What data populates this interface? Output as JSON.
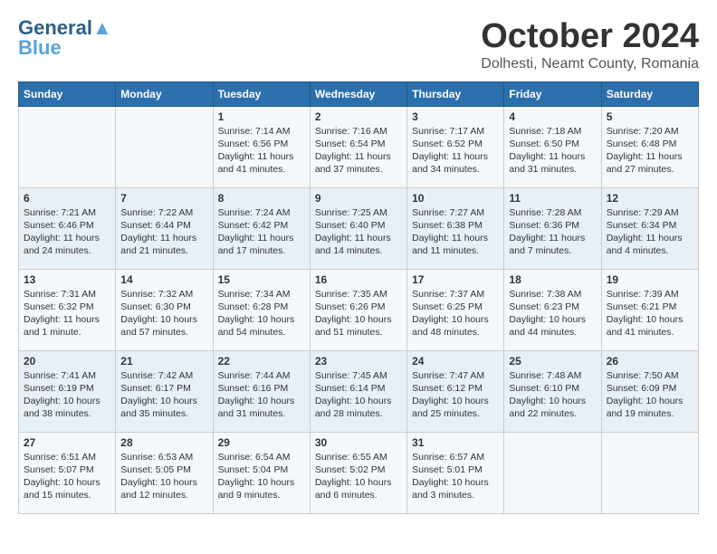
{
  "header": {
    "logo_general": "General",
    "logo_blue": "Blue",
    "month_title": "October 2024",
    "location": "Dolhesti, Neamt County, Romania"
  },
  "weekdays": [
    "Sunday",
    "Monday",
    "Tuesday",
    "Wednesday",
    "Thursday",
    "Friday",
    "Saturday"
  ],
  "weeks": [
    [
      {
        "day": "",
        "info": ""
      },
      {
        "day": "",
        "info": ""
      },
      {
        "day": "1",
        "info": "Sunrise: 7:14 AM\nSunset: 6:56 PM\nDaylight: 11 hours and 41 minutes."
      },
      {
        "day": "2",
        "info": "Sunrise: 7:16 AM\nSunset: 6:54 PM\nDaylight: 11 hours and 37 minutes."
      },
      {
        "day": "3",
        "info": "Sunrise: 7:17 AM\nSunset: 6:52 PM\nDaylight: 11 hours and 34 minutes."
      },
      {
        "day": "4",
        "info": "Sunrise: 7:18 AM\nSunset: 6:50 PM\nDaylight: 11 hours and 31 minutes."
      },
      {
        "day": "5",
        "info": "Sunrise: 7:20 AM\nSunset: 6:48 PM\nDaylight: 11 hours and 27 minutes."
      }
    ],
    [
      {
        "day": "6",
        "info": "Sunrise: 7:21 AM\nSunset: 6:46 PM\nDaylight: 11 hours and 24 minutes."
      },
      {
        "day": "7",
        "info": "Sunrise: 7:22 AM\nSunset: 6:44 PM\nDaylight: 11 hours and 21 minutes."
      },
      {
        "day": "8",
        "info": "Sunrise: 7:24 AM\nSunset: 6:42 PM\nDaylight: 11 hours and 17 minutes."
      },
      {
        "day": "9",
        "info": "Sunrise: 7:25 AM\nSunset: 6:40 PM\nDaylight: 11 hours and 14 minutes."
      },
      {
        "day": "10",
        "info": "Sunrise: 7:27 AM\nSunset: 6:38 PM\nDaylight: 11 hours and 11 minutes."
      },
      {
        "day": "11",
        "info": "Sunrise: 7:28 AM\nSunset: 6:36 PM\nDaylight: 11 hours and 7 minutes."
      },
      {
        "day": "12",
        "info": "Sunrise: 7:29 AM\nSunset: 6:34 PM\nDaylight: 11 hours and 4 minutes."
      }
    ],
    [
      {
        "day": "13",
        "info": "Sunrise: 7:31 AM\nSunset: 6:32 PM\nDaylight: 11 hours and 1 minute."
      },
      {
        "day": "14",
        "info": "Sunrise: 7:32 AM\nSunset: 6:30 PM\nDaylight: 10 hours and 57 minutes."
      },
      {
        "day": "15",
        "info": "Sunrise: 7:34 AM\nSunset: 6:28 PM\nDaylight: 10 hours and 54 minutes."
      },
      {
        "day": "16",
        "info": "Sunrise: 7:35 AM\nSunset: 6:26 PM\nDaylight: 10 hours and 51 minutes."
      },
      {
        "day": "17",
        "info": "Sunrise: 7:37 AM\nSunset: 6:25 PM\nDaylight: 10 hours and 48 minutes."
      },
      {
        "day": "18",
        "info": "Sunrise: 7:38 AM\nSunset: 6:23 PM\nDaylight: 10 hours and 44 minutes."
      },
      {
        "day": "19",
        "info": "Sunrise: 7:39 AM\nSunset: 6:21 PM\nDaylight: 10 hours and 41 minutes."
      }
    ],
    [
      {
        "day": "20",
        "info": "Sunrise: 7:41 AM\nSunset: 6:19 PM\nDaylight: 10 hours and 38 minutes."
      },
      {
        "day": "21",
        "info": "Sunrise: 7:42 AM\nSunset: 6:17 PM\nDaylight: 10 hours and 35 minutes."
      },
      {
        "day": "22",
        "info": "Sunrise: 7:44 AM\nSunset: 6:16 PM\nDaylight: 10 hours and 31 minutes."
      },
      {
        "day": "23",
        "info": "Sunrise: 7:45 AM\nSunset: 6:14 PM\nDaylight: 10 hours and 28 minutes."
      },
      {
        "day": "24",
        "info": "Sunrise: 7:47 AM\nSunset: 6:12 PM\nDaylight: 10 hours and 25 minutes."
      },
      {
        "day": "25",
        "info": "Sunrise: 7:48 AM\nSunset: 6:10 PM\nDaylight: 10 hours and 22 minutes."
      },
      {
        "day": "26",
        "info": "Sunrise: 7:50 AM\nSunset: 6:09 PM\nDaylight: 10 hours and 19 minutes."
      }
    ],
    [
      {
        "day": "27",
        "info": "Sunrise: 6:51 AM\nSunset: 5:07 PM\nDaylight: 10 hours and 15 minutes."
      },
      {
        "day": "28",
        "info": "Sunrise: 6:53 AM\nSunset: 5:05 PM\nDaylight: 10 hours and 12 minutes."
      },
      {
        "day": "29",
        "info": "Sunrise: 6:54 AM\nSunset: 5:04 PM\nDaylight: 10 hours and 9 minutes."
      },
      {
        "day": "30",
        "info": "Sunrise: 6:55 AM\nSunset: 5:02 PM\nDaylight: 10 hours and 6 minutes."
      },
      {
        "day": "31",
        "info": "Sunrise: 6:57 AM\nSunset: 5:01 PM\nDaylight: 10 hours and 3 minutes."
      },
      {
        "day": "",
        "info": ""
      },
      {
        "day": "",
        "info": ""
      }
    ]
  ]
}
